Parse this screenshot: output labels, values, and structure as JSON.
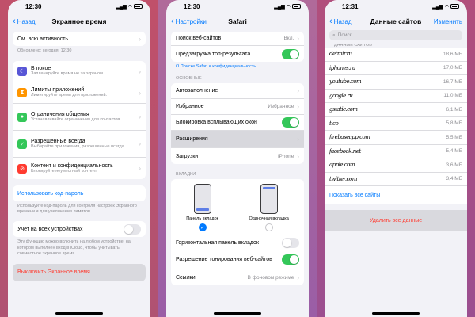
{
  "phone1": {
    "time": "12:30",
    "back": "Назад",
    "title": "Экранное время",
    "all_activity": "См. всю активность",
    "updated": "Обновлено: сегодня, 12:30",
    "items": [
      {
        "label": "В покое",
        "sub": "Запланируйте время не за экраном.",
        "color": "#5856d6",
        "icon": "moon-icon"
      },
      {
        "label": "Лимиты приложений",
        "sub": "Лимитируйте время для приложений.",
        "color": "#ff9500",
        "icon": "hourglass-icon"
      },
      {
        "label": "Ограничения общения",
        "sub": "Устанавливайте ограничения для контактов.",
        "color": "#34c759",
        "icon": "person-icon"
      },
      {
        "label": "Разрешенные всегда",
        "sub": "Выбирайте приложения, разрешенные всегда.",
        "color": "#34c759",
        "icon": "checkmark-icon"
      },
      {
        "label": "Контент и конфиденциальность",
        "sub": "Блокируйте неуместный контент.",
        "color": "#ff3b30",
        "icon": "block-icon"
      }
    ],
    "passcode_link": "Использовать код-пароль",
    "passcode_note": "Используйте код-пароль для контроля настроек Экранного времени и для увеличения лимитов.",
    "all_devices": "Учет на всех устройствах",
    "all_devices_note": "Эту функцию можно включить на любом устройстве, на котором выполнен вход в iCloud, чтобы учитывать совместное экранное время.",
    "disable": "Выключить Экранное время"
  },
  "phone2": {
    "time": "12:30",
    "back": "Настройки",
    "title": "Safari",
    "search_engine": "Поиск веб-сайтов",
    "search_engine_value": "Вкл.",
    "preload": "Предзагрузка топ-результата",
    "privacy_link": "О Поиске Safari и конфиденциальность...",
    "section_basic": "Основные",
    "autofill": "Автозаполнение",
    "favorites": "Избранное",
    "favorites_value": "Избранное",
    "block_popups": "Блокировка всплывающих окон",
    "extensions": "Расширения",
    "downloads": "Загрузки",
    "downloads_value": "iPhone",
    "section_tabs": "Вкладки",
    "tab_bar": "Панель вкладок",
    "single_tab": "Одиночная вкладка",
    "landscape_tab_bar": "Горизонтальная панель вкладок",
    "allow_tinting": "Разрешение тонирования веб-сайтов",
    "links": "Ссылки",
    "links_value": "В фоновом режиме"
  },
  "phone3": {
    "time": "12:31",
    "back": "Назад",
    "title": "Данные сайтов",
    "edit": "Изменить",
    "search_placeholder": "Поиск",
    "section": "Данные сайтов",
    "sites": [
      {
        "name": "detmir.ru",
        "size": "18,6 МБ"
      },
      {
        "name": "iphones.ru",
        "size": "17,0 МБ"
      },
      {
        "name": "youtube.com",
        "size": "16,7 МБ"
      },
      {
        "name": "google.ru",
        "size": "11,0 МБ"
      },
      {
        "name": "gstatic.com",
        "size": "6,1 МБ"
      },
      {
        "name": "t.co",
        "size": "5,8 МБ"
      },
      {
        "name": "firebaseapp.com",
        "size": "5,5 МБ"
      },
      {
        "name": "facebook.net",
        "size": "5,4 МБ"
      },
      {
        "name": "apple.com",
        "size": "3,6 МБ"
      },
      {
        "name": "twitter.com",
        "size": "3,4 МБ"
      }
    ],
    "show_all": "Показать все сайты",
    "delete_all": "Удалить все данные"
  }
}
